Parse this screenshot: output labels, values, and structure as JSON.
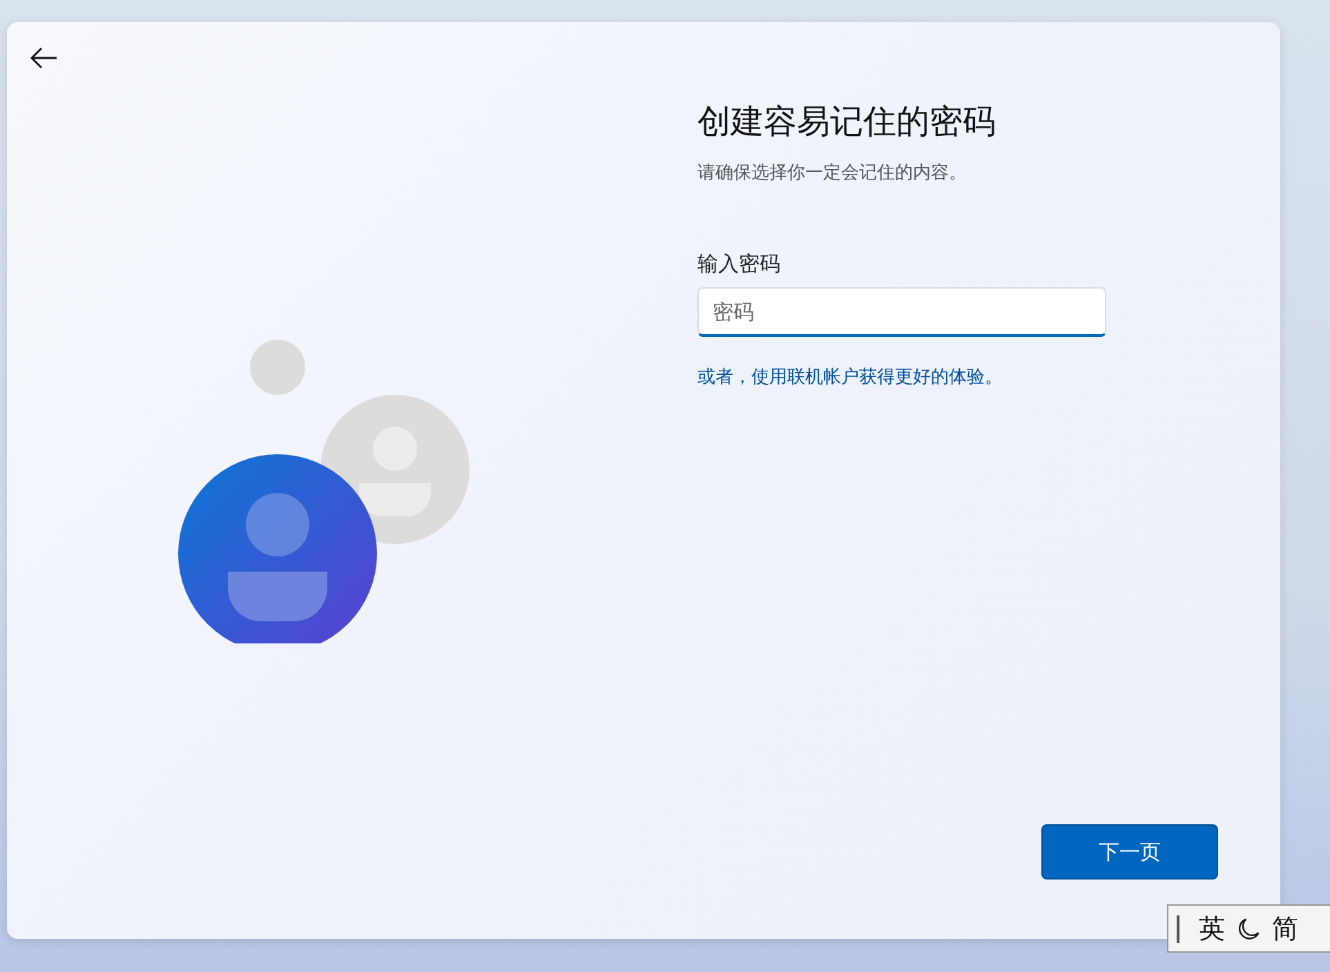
{
  "setup_page": {
    "title": "创建容易记住的密码",
    "subtitle": "请确保选择你一定会记住的内容。",
    "password_field": {
      "label": "输入密码",
      "placeholder": "密码",
      "focused": true
    },
    "link": "或者，使用联机帐户获得更好的体验。",
    "next_button": {
      "label": "下一页"
    }
  },
  "ime_bar": {
    "items": [
      {
        "kind": "grip"
      },
      {
        "kind": "text",
        "label": "英"
      },
      {
        "kind": "moon"
      },
      {
        "kind": "text",
        "label": "简"
      }
    ]
  }
}
